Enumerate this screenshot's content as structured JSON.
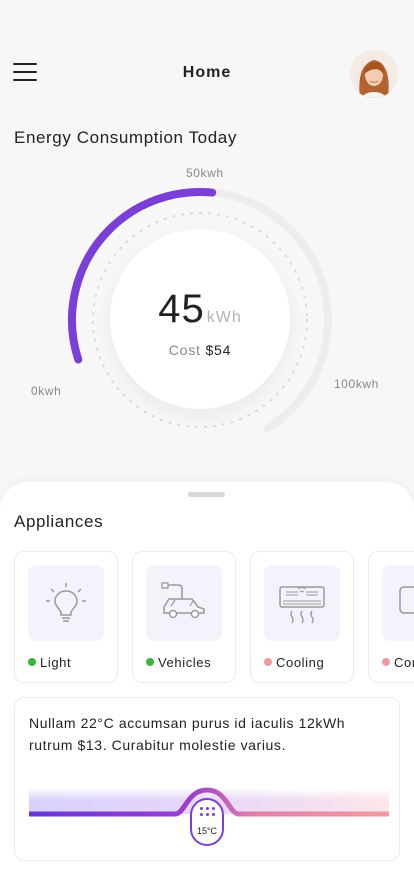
{
  "header": {
    "title": "Home"
  },
  "energy": {
    "section_title": "Energy Consumption Today",
    "value": "45",
    "unit": "kWh",
    "cost_label": "Cost",
    "cost_value": "$54",
    "label_min": "0kwh",
    "label_mid": "50kwh",
    "label_max": "100kwh",
    "progress_fraction": 0.45,
    "accent_color": "#7a3fd6"
  },
  "appliances": {
    "title": "Appliances",
    "items": [
      {
        "label": "Light",
        "status_color": "#3cb43c",
        "icon": "lightbulb-icon"
      },
      {
        "label": "Vehicles",
        "status_color": "#3cb43c",
        "icon": "ev-car-icon"
      },
      {
        "label": "Cooling",
        "status_color": "#f29a9a",
        "icon": "air-conditioner-icon"
      },
      {
        "label": "Computer",
        "status_color": "#f29a9a",
        "icon": "computer-icon"
      }
    ]
  },
  "info_card": {
    "text": "Nullam 22°C accumsan purus id iaculis 12kWh rutrum $13. Curabitur molestie varius.",
    "temperature": "15°C"
  }
}
